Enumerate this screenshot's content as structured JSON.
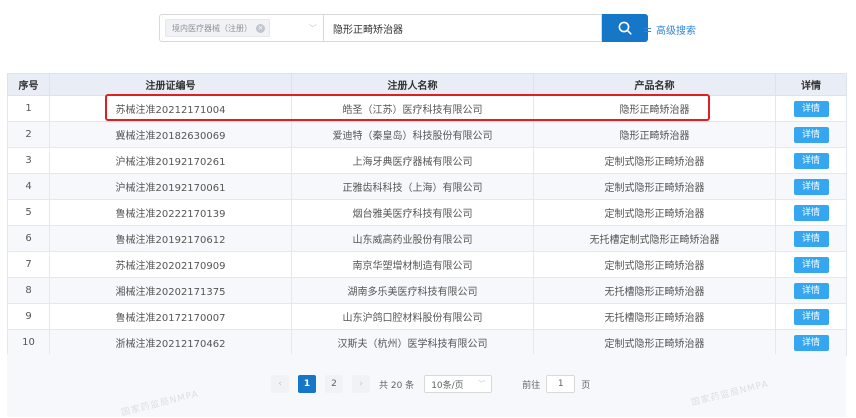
{
  "search": {
    "category_tag": "境内医疗器械（注册）",
    "keyword": "隐形正畸矫治器",
    "advanced_label": "高级搜索"
  },
  "table": {
    "headers": [
      "序号",
      "注册证编号",
      "注册人名称",
      "产品名称",
      "详情"
    ],
    "rows": [
      {
        "no": "1",
        "reg": "苏械注准20212171004",
        "company": "皓圣（江苏）医疗科技有限公司",
        "product": "隐形正畸矫治器",
        "detail": "详情"
      },
      {
        "no": "2",
        "reg": "冀械注准20182630069",
        "company": "爱迪特（秦皇岛）科技股份有限公司",
        "product": "隐形正畸矫治器",
        "detail": "详情"
      },
      {
        "no": "3",
        "reg": "沪械注准20192170261",
        "company": "上海牙典医疗器械有限公司",
        "product": "定制式隐形正畸矫治器",
        "detail": "详情"
      },
      {
        "no": "4",
        "reg": "沪械注准20192170061",
        "company": "正雅齿科科技（上海）有限公司",
        "product": "定制式隐形正畸矫治器",
        "detail": "详情"
      },
      {
        "no": "5",
        "reg": "鲁械注准20222170139",
        "company": "烟台雅美医疗科技有限公司",
        "product": "定制式隐形正畸矫治器",
        "detail": "详情"
      },
      {
        "no": "6",
        "reg": "鲁械注准20192170612",
        "company": "山东威高药业股份有限公司",
        "product": "无托槽定制式隐形正畸矫治器",
        "detail": "详情"
      },
      {
        "no": "7",
        "reg": "苏械注准20202170909",
        "company": "南京华塑增材制造有限公司",
        "product": "定制式隐形正畸矫治器",
        "detail": "详情"
      },
      {
        "no": "8",
        "reg": "湘械注准20202171375",
        "company": "湖南多乐美医疗科技有限公司",
        "product": "无托槽隐形正畸矫治器",
        "detail": "详情"
      },
      {
        "no": "9",
        "reg": "鲁械注准20172170007",
        "company": "山东沪鸽口腔材料股份有限公司",
        "product": "无托槽隐形正畸矫治器",
        "detail": "详情"
      },
      {
        "no": "10",
        "reg": "浙械注准20212170462",
        "company": "汉斯夫（杭州）医学科技有限公司",
        "product": "定制式隐形正畸矫治器",
        "detail": "详情"
      }
    ]
  },
  "pagination": {
    "prev": "‹",
    "pages": [
      "1",
      "2"
    ],
    "next": "›",
    "total": "共 20 条",
    "page_size": "10条/页",
    "goto_label": "前往",
    "jump_value": "1",
    "page_suffix": "页"
  },
  "watermark": "国家药监局NMPA",
  "colors": {
    "primary": "#1677c8",
    "detail_button": "#35a7f1",
    "highlight": "#e02020",
    "header_bg": "#e9eef6"
  }
}
